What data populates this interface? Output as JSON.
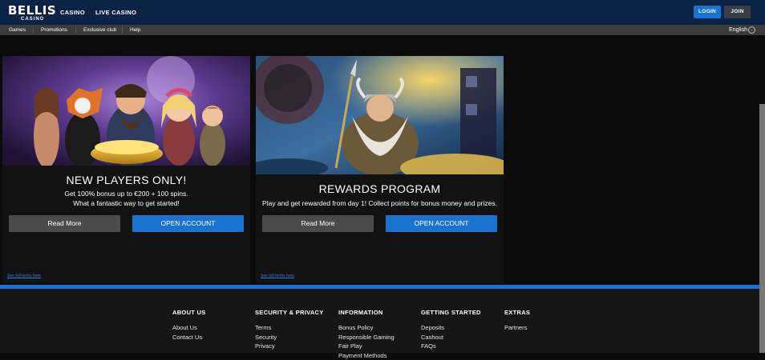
{
  "header": {
    "logo_main": "BELLIS",
    "logo_sub": "CASINO",
    "nav": [
      "CASINO",
      "LIVE CASINO"
    ],
    "login_label": "LOGIN",
    "join_label": "JOIN"
  },
  "subnav": {
    "items": [
      "Games",
      "Promotions",
      "Exclusive club",
      "Help"
    ],
    "language": "English"
  },
  "cards": [
    {
      "title": "NEW PLAYERS ONLY!",
      "text_lines": [
        "Get 100% bonus up to €200 + 100 spins.",
        "What a fantastic way to get started!"
      ],
      "read_more": "Read More",
      "open_account": "OPEN ACCOUNT",
      "terms": "See full terms here"
    },
    {
      "title": "REWARDS PROGRAM",
      "text_lines": [
        "Play and get rewarded from day 1! Collect points for bonus money and prizes."
      ],
      "read_more": "Read More",
      "open_account": "OPEN ACCOUNT",
      "terms": "See full terms here"
    }
  ],
  "footer": {
    "columns": [
      {
        "heading": "ABOUT US",
        "links": [
          "About Us",
          "Contact Us"
        ]
      },
      {
        "heading": "SECURITY & PRIVACY",
        "links": [
          "Terms",
          "Security",
          "Privacy"
        ]
      },
      {
        "heading": "INFORMATION",
        "links": [
          "Bonus Policy",
          "Responsible Gaming",
          "Fair Play",
          "Payment Methods"
        ]
      },
      {
        "heading": "GETTING STARTED",
        "links": [
          "Deposits",
          "Cashout",
          "FAQs"
        ]
      },
      {
        "heading": "EXTRAS",
        "links": [
          "Partners"
        ]
      }
    ]
  },
  "colors": {
    "topbar": "#0b2446",
    "accent": "#1a73d1",
    "subbar": "#3b3b3b",
    "page_bg": "#0b0b0b"
  }
}
